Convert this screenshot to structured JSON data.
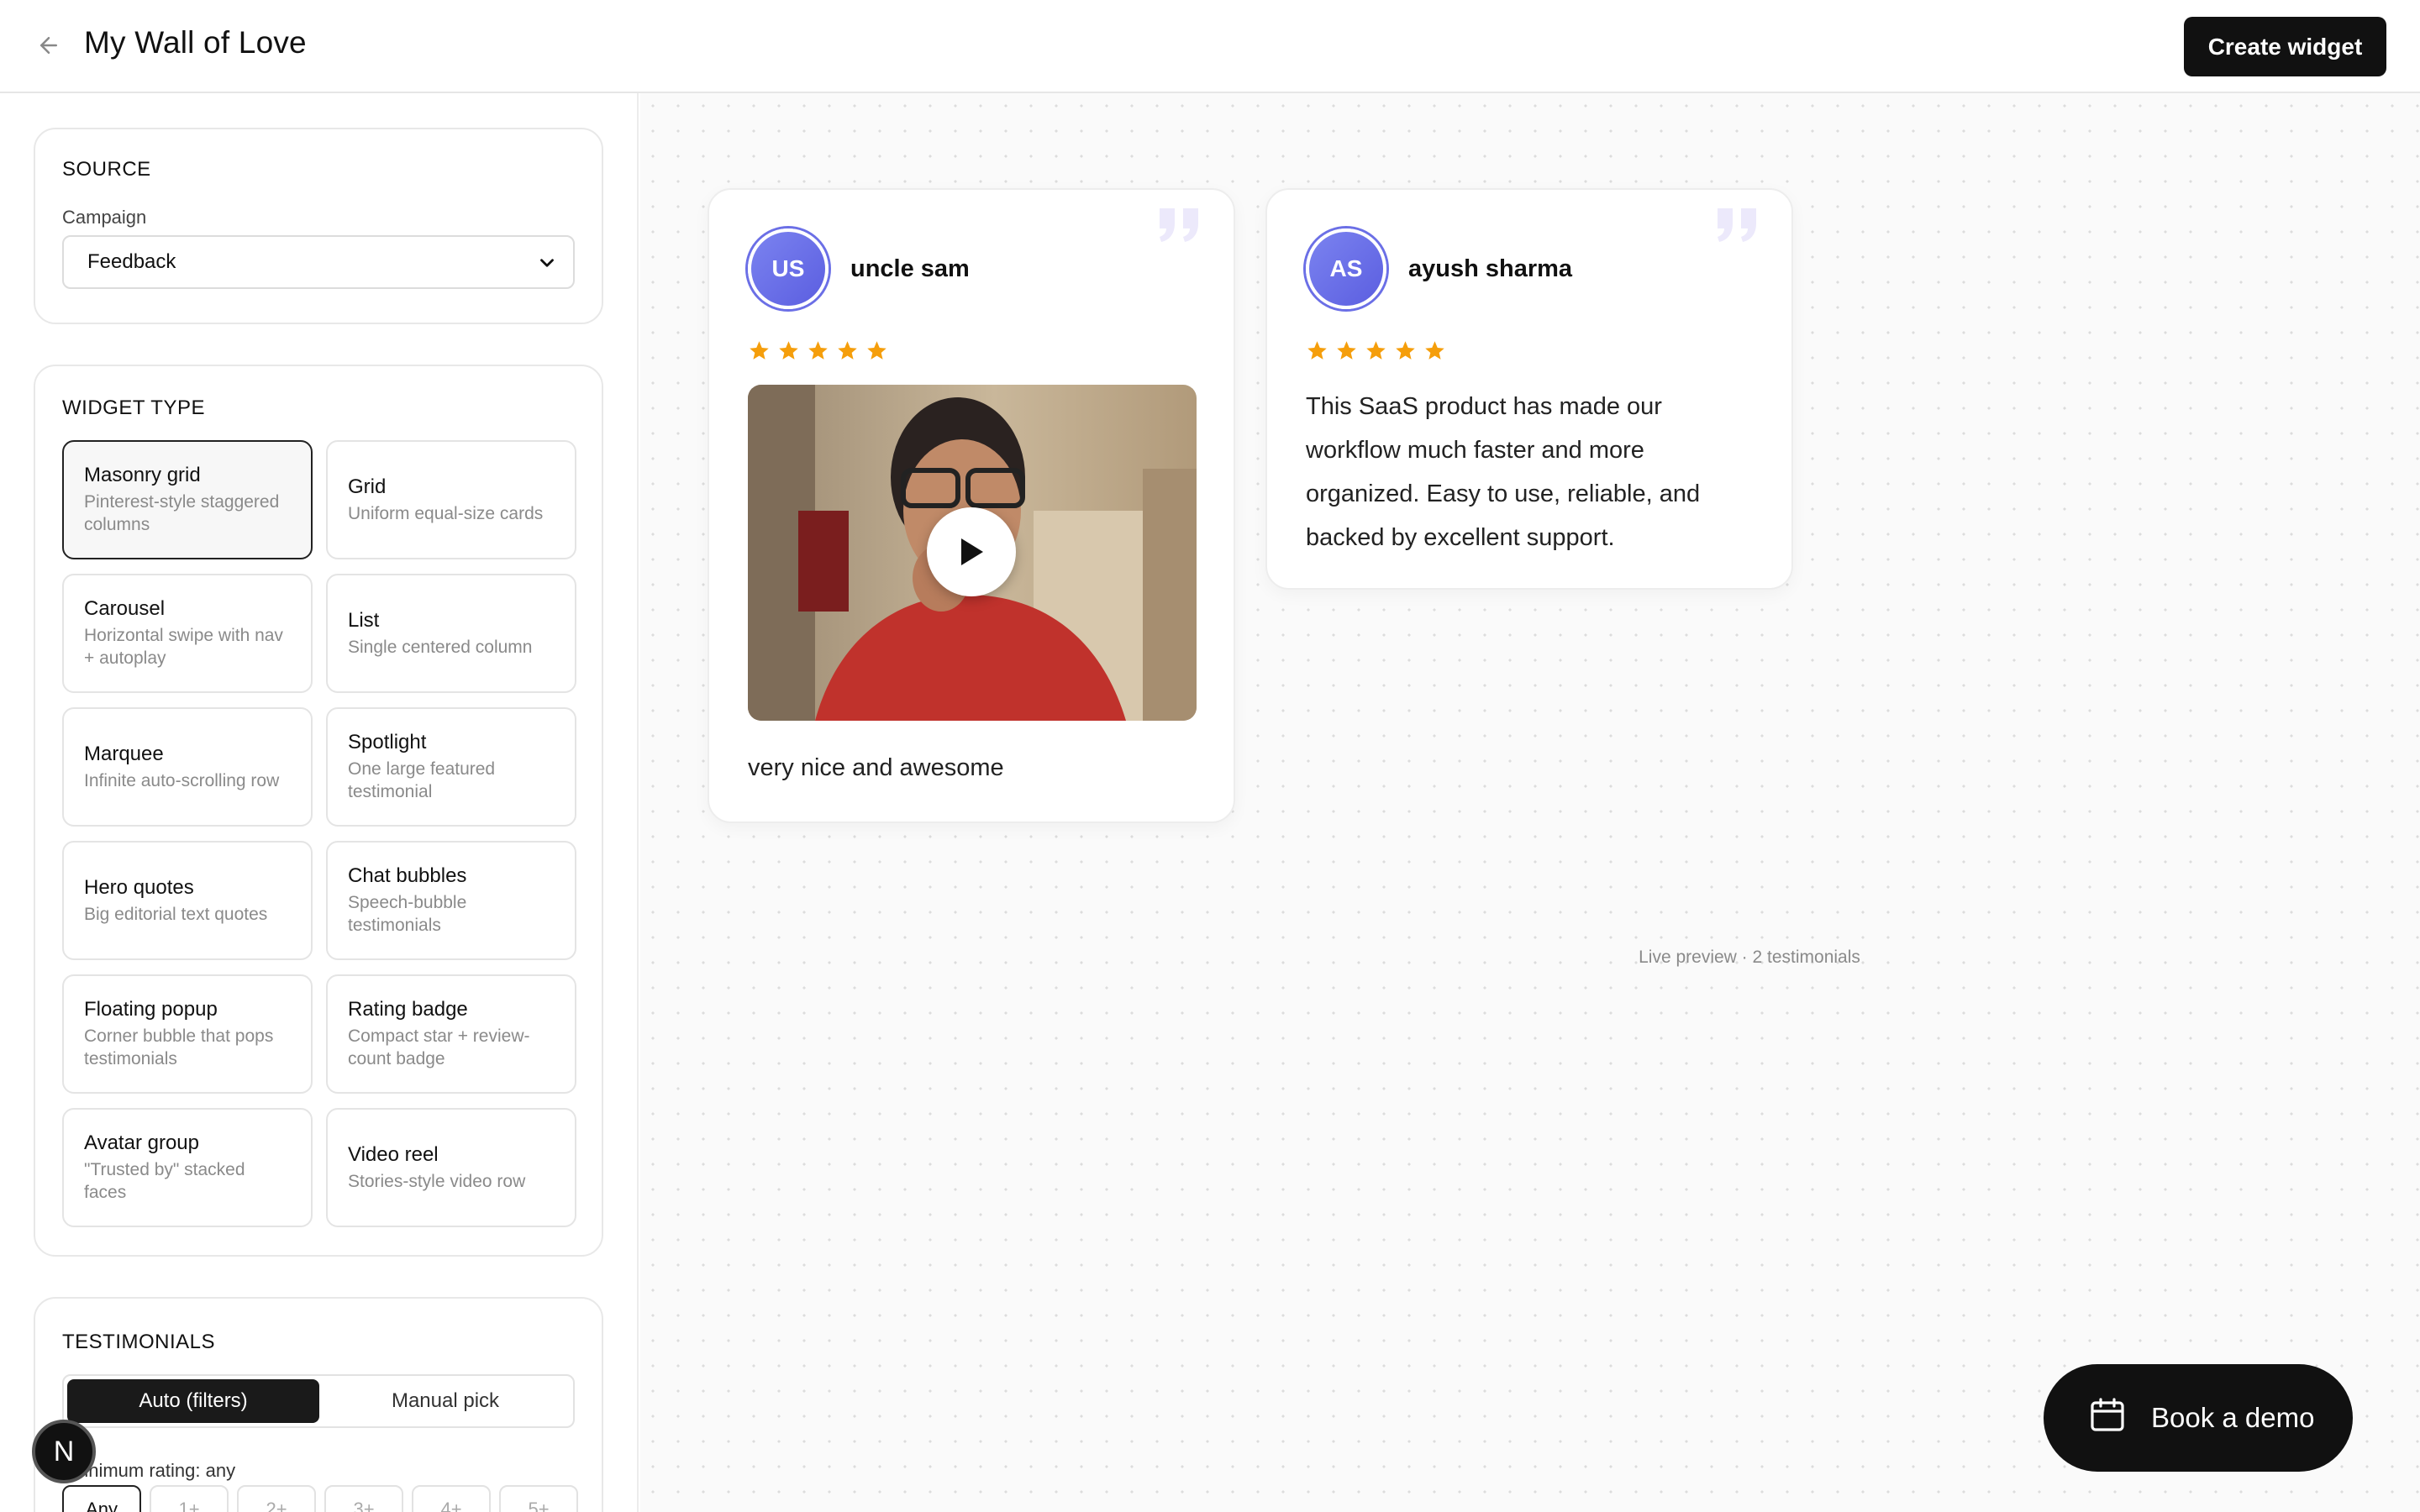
{
  "header": {
    "title": "My Wall of Love",
    "create_label": "Create widget"
  },
  "source": {
    "heading": "SOURCE",
    "campaign_label": "Campaign",
    "campaign_value": "Feedback"
  },
  "widget_type": {
    "heading": "WIDGET TYPE",
    "selected": "Masonry grid",
    "items": [
      {
        "name": "Masonry grid",
        "desc": "Pinterest-style staggered columns"
      },
      {
        "name": "Grid",
        "desc": "Uniform equal-size cards"
      },
      {
        "name": "Carousel",
        "desc": "Horizontal swipe with nav + autoplay"
      },
      {
        "name": "List",
        "desc": "Single centered column"
      },
      {
        "name": "Marquee",
        "desc": "Infinite auto-scrolling row"
      },
      {
        "name": "Spotlight",
        "desc": "One large featured testimonial"
      },
      {
        "name": "Hero quotes",
        "desc": "Big editorial text quotes"
      },
      {
        "name": "Chat bubbles",
        "desc": "Speech-bubble testimonials"
      },
      {
        "name": "Floating popup",
        "desc": "Corner bubble that pops testimonials"
      },
      {
        "name": "Rating badge",
        "desc": "Compact star + review-count badge"
      },
      {
        "name": "Avatar group",
        "desc": "\"Trusted by\" stacked faces"
      },
      {
        "name": "Video reel",
        "desc": "Stories-style video row"
      }
    ]
  },
  "testimonials_panel": {
    "heading": "TESTIMONIALS",
    "mode_auto": "Auto (filters)",
    "mode_manual": "Manual pick",
    "min_rating_label": "Minimum rating: any",
    "rating_options": [
      "Any",
      "1+",
      "2+",
      "3+",
      "4+",
      "5+"
    ]
  },
  "preview": {
    "cards": [
      {
        "initials": "US",
        "name": "uncle sam",
        "rating": 5,
        "has_video": true,
        "text": "very nice and awesome"
      },
      {
        "initials": "AS",
        "name": "ayush sharma",
        "rating": 5,
        "has_video": false,
        "text_lines": [
          "This SaaS product has made our",
          "workflow much faster and more",
          "organized. Easy to use, reliable, and",
          "backed by excellent support."
        ]
      }
    ],
    "caption": "Live preview · 2 testimonials"
  },
  "book_demo_label": "Book a demo",
  "dev_badge": "N",
  "colors": {
    "accent": "#6b6fe6",
    "star": "#f59e0b",
    "primary_button": "#111111"
  }
}
